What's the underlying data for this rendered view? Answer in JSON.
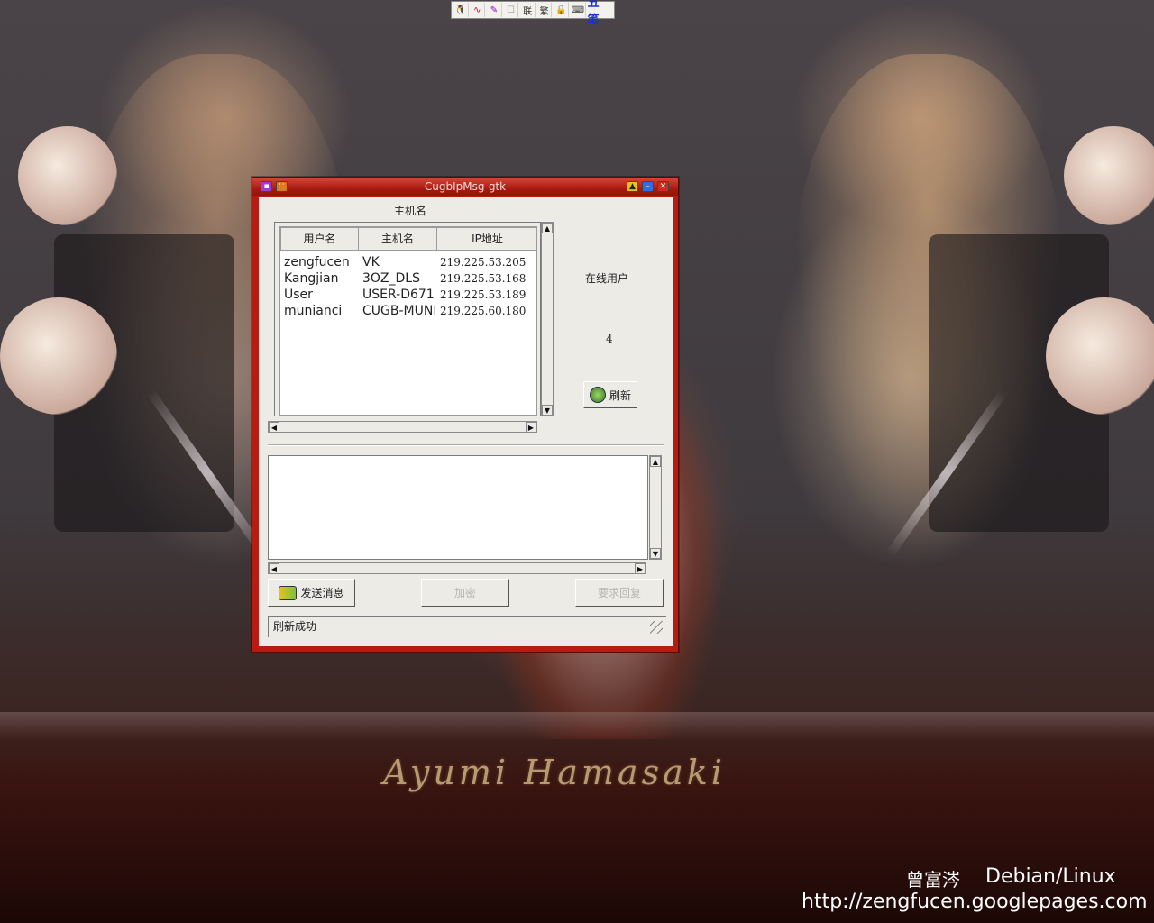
{
  "ime_toolbar": {
    "icons": [
      "penguin-icon",
      "ime-dots-icon",
      "brush-icon",
      "punctuation-icon",
      "lian-icon",
      "fan-icon",
      "lock-icon",
      "keyboard-icon"
    ],
    "lian": "联",
    "fan": "繁",
    "mode": "五笔"
  },
  "window": {
    "title": "CugbIpMsg-gtk",
    "host_label": "主机名",
    "columns": [
      "用户名",
      "主机名",
      "IP地址"
    ],
    "users": [
      {
        "user": "zengfucen",
        "host": "VK",
        "ip": "219.225.53.205"
      },
      {
        "user": "Kangjian",
        "host": "3OZ_DLS",
        "ip": "219.225.53.168"
      },
      {
        "user": "User",
        "host": "USER-D671",
        "ip": "219.225.53.189"
      },
      {
        "user": "munianci",
        "host": "CUGB-MUNI",
        "ip": "219.225.60.180"
      }
    ],
    "online_label": "在线用户",
    "online_count": "4",
    "refresh_label": "刷新",
    "send_label": "发送消息",
    "encrypt_label": "加密",
    "reply_label": "要求回复",
    "status": "刷新成功"
  },
  "desktop": {
    "signature": "Ayumi Hamasaki",
    "credit_name": "曾富涔",
    "credit_os": "Debian/Linux",
    "credit_url": "http://zengfucen.googlepages.com"
  }
}
